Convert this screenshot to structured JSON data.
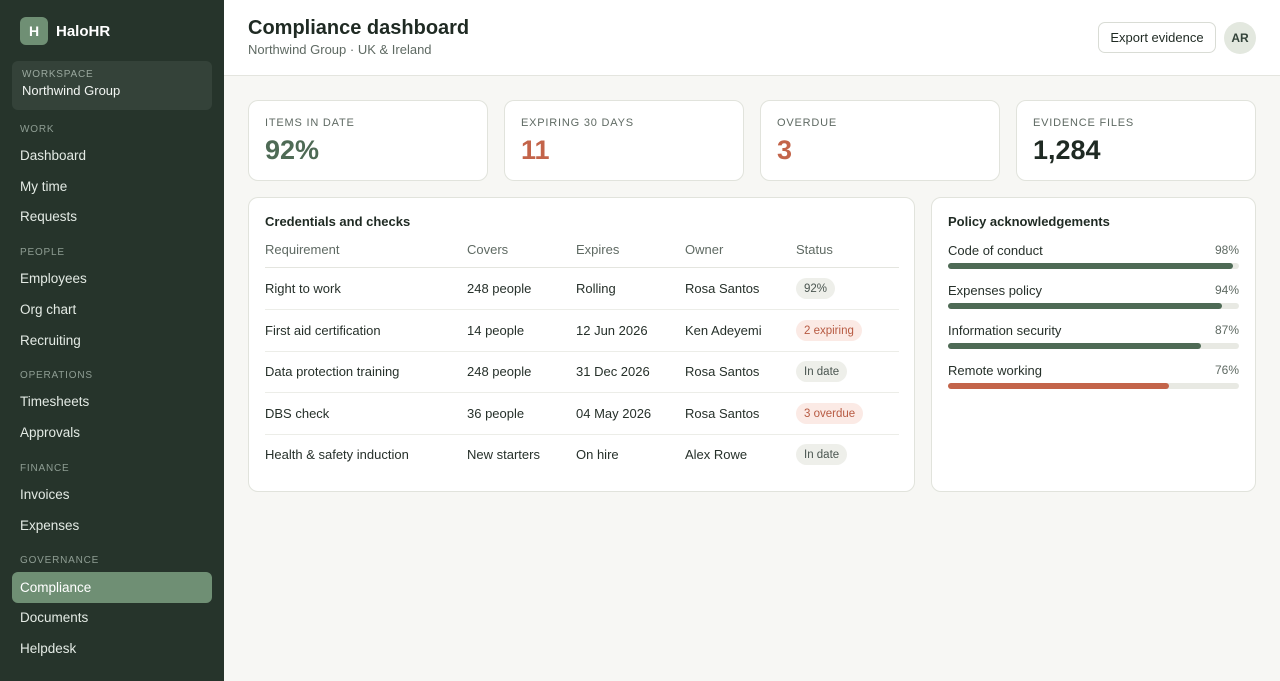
{
  "brand": {
    "initial": "H",
    "name": "HaloHR"
  },
  "workspace": {
    "label": "WORKSPACE",
    "name": "Northwind Group"
  },
  "nav": {
    "sections": [
      {
        "label": "WORK",
        "items": [
          "Dashboard",
          "My time",
          "Requests"
        ]
      },
      {
        "label": "PEOPLE",
        "items": [
          "Employees",
          "Org chart",
          "Recruiting"
        ]
      },
      {
        "label": "OPERATIONS",
        "items": [
          "Timesheets",
          "Approvals"
        ]
      },
      {
        "label": "FINANCE",
        "items": [
          "Invoices",
          "Expenses"
        ]
      },
      {
        "label": "GOVERNANCE",
        "items": [
          "Compliance",
          "Documents",
          "Helpdesk"
        ]
      }
    ],
    "active": "Compliance"
  },
  "header": {
    "title": "Compliance dashboard",
    "subtitle": "Northwind Group · UK & Ireland",
    "export_label": "Export evidence",
    "avatar_initials": "AR"
  },
  "kpis": [
    {
      "label": "ITEMS IN DATE",
      "value": "92%",
      "tone": "green"
    },
    {
      "label": "EXPIRING 30 DAYS",
      "value": "11",
      "tone": "orange"
    },
    {
      "label": "OVERDUE",
      "value": "3",
      "tone": "orange"
    },
    {
      "label": "EVIDENCE FILES",
      "value": "1,284",
      "tone": "dark"
    }
  ],
  "credentials": {
    "title": "Credentials and checks",
    "columns": [
      "Requirement",
      "Covers",
      "Expires",
      "Owner",
      "Status"
    ],
    "rows": [
      {
        "requirement": "Right to work",
        "covers": "248 people",
        "expires": "Rolling",
        "owner": "Rosa Santos",
        "status": "92%",
        "tone": "neutral"
      },
      {
        "requirement": "First aid certification",
        "covers": "14 people",
        "expires": "12 Jun 2026",
        "owner": "Ken Adeyemi",
        "status": "2 expiring",
        "tone": "warn"
      },
      {
        "requirement": "Data protection training",
        "covers": "248 people",
        "expires": "31 Dec 2026",
        "owner": "Rosa Santos",
        "status": "In date",
        "tone": "neutral"
      },
      {
        "requirement": "DBS check",
        "covers": "36 people",
        "expires": "04 May 2026",
        "owner": "Rosa Santos",
        "status": "3 overdue",
        "tone": "warn"
      },
      {
        "requirement": "Health & safety induction",
        "covers": "New starters",
        "expires": "On hire",
        "owner": "Alex Rowe",
        "status": "In date",
        "tone": "neutral"
      }
    ]
  },
  "policies": {
    "title": "Policy acknowledgements",
    "items": [
      {
        "name": "Code of conduct",
        "percent": 98,
        "percent_label": "98%",
        "color": "#4e6a55"
      },
      {
        "name": "Expenses policy",
        "percent": 94,
        "percent_label": "94%",
        "color": "#4e6a55"
      },
      {
        "name": "Information security",
        "percent": 87,
        "percent_label": "87%",
        "color": "#4e6a55"
      },
      {
        "name": "Remote working",
        "percent": 76,
        "percent_label": "76%",
        "color": "#c3644a"
      }
    ]
  },
  "colors": {
    "sidebar": "#26342b",
    "accent": "#6f8f74",
    "positive": "#4e6a55",
    "warning": "#c3644a"
  }
}
